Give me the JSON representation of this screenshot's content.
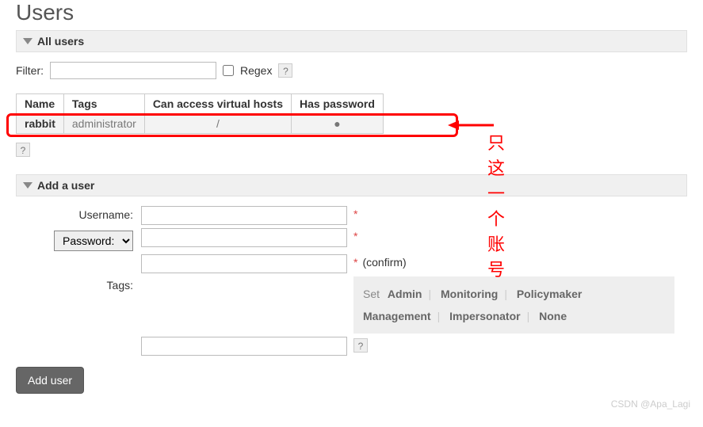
{
  "page": {
    "title": "Users"
  },
  "sections": {
    "all_users": {
      "title": "All users"
    },
    "add_user": {
      "title": "Add a user"
    }
  },
  "filter": {
    "label": "Filter:",
    "value": "",
    "regex_label": "Regex",
    "help": "?"
  },
  "table": {
    "headers": {
      "name": "Name",
      "tags": "Tags",
      "vhosts": "Can access virtual hosts",
      "password": "Has password"
    },
    "rows": [
      {
        "name": "rabbit",
        "tags": "administrator",
        "vhosts": "/",
        "password": "●"
      }
    ],
    "help": "?"
  },
  "annotation": {
    "text": "只这一个账号"
  },
  "form": {
    "username_label": "Username:",
    "username_value": "",
    "password_type_label": "Password:",
    "password_value": "",
    "confirm_value": "",
    "confirm_text": "(confirm)",
    "tags_label": "Tags:",
    "tags_value": "",
    "required": "*",
    "help": "?",
    "tag_set_label": "Set",
    "tag_options": [
      "Admin",
      "Monitoring",
      "Policymaker",
      "Management",
      "Impersonator",
      "None"
    ],
    "submit": "Add user"
  },
  "watermark": "CSDN @Apa_Lagi"
}
